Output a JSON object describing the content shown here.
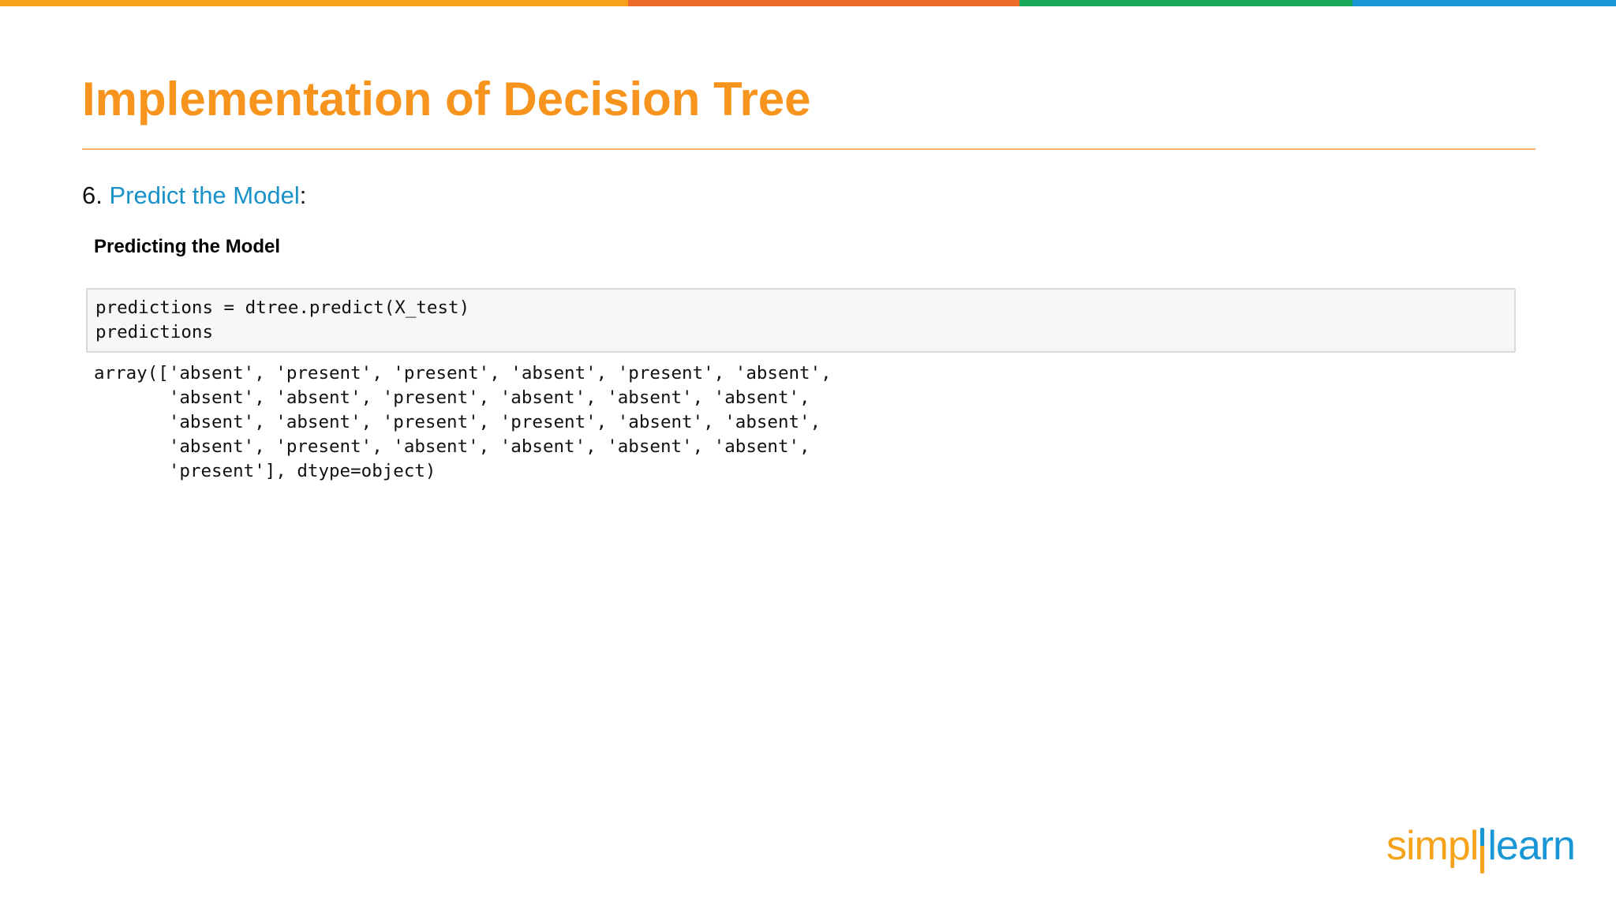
{
  "header": {
    "stripe_colors": [
      "#F7A21B",
      "#EE6A2B",
      "#17A85A",
      "#1896D6"
    ]
  },
  "slide": {
    "title": "Implementation of Decision Tree",
    "title_color": "#F7941D",
    "step_number": "6.",
    "step_link_text": "Predict the Model",
    "step_suffix": ":",
    "link_color": "#1A92C8",
    "section_heading": "Predicting the Model"
  },
  "notebook": {
    "input_lines": [
      "predictions = dtree.predict(X_test)",
      "predictions"
    ],
    "output_lines": [
      "array(['absent', 'present', 'present', 'absent', 'present', 'absent',",
      "       'absent', 'absent', 'present', 'absent', 'absent', 'absent',",
      "       'absent', 'absent', 'present', 'present', 'absent', 'absent',",
      "       'absent', 'present', 'absent', 'absent', 'absent', 'absent',",
      "       'present'], dtype=object)"
    ]
  },
  "brand": {
    "logo_part1": "simpl",
    "logo_part2": "learn",
    "primary_color": "#F7A21B",
    "secondary_color": "#1896D6"
  }
}
